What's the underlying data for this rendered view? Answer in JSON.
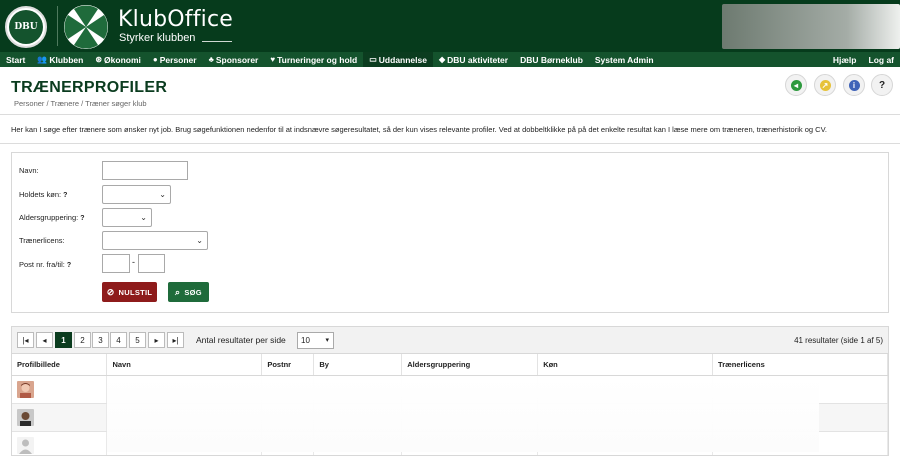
{
  "header": {
    "dbu_logo_text": "DBU",
    "brand_title": "KlubOffice",
    "brand_subtitle": "Styrker klubben"
  },
  "nav": {
    "items": [
      {
        "label": "Start",
        "icon": ""
      },
      {
        "label": "Klubben",
        "icon": "people-icon"
      },
      {
        "label": "Økonomi",
        "icon": "coin-icon"
      },
      {
        "label": "Personer",
        "icon": "person-icon"
      },
      {
        "label": "Sponsorer",
        "icon": "sponsor-icon"
      },
      {
        "label": "Turneringer og hold",
        "icon": "trophy-icon"
      },
      {
        "label": "Uddannelse",
        "icon": "monitor-icon",
        "active": true
      },
      {
        "label": "DBU aktiviteter",
        "icon": "graduation-icon"
      },
      {
        "label": "DBU Børneklub",
        "icon": ""
      },
      {
        "label": "System Admin",
        "icon": ""
      }
    ],
    "right": [
      "Hjælp",
      "Log af"
    ]
  },
  "page": {
    "title": "TRÆNERPROFILER",
    "breadcrumb": "Personer / Trænere / Træner søger klub",
    "intro": "Her kan I søge efter trænere som ønsker nyt job. Brug søgefunktionen nedenfor til at indsnævre søgeresultatet, så der kun vises relevante profiler. Ved at dobbeltklikke på på det enkelte resultat kan I læse mere om træneren, trænerhistorik og CV."
  },
  "toolbar_buttons": {
    "back_icon": "back-arrow-icon",
    "export_icon": "export-icon",
    "info_icon": "info-icon",
    "help_symbol": "?"
  },
  "search": {
    "name_label": "Navn:",
    "name_value": "",
    "team_gender_label": "Holdets køn:",
    "team_gender_value": "",
    "age_group_label": "Aldersgruppering:",
    "age_group_value": "",
    "license_label": "Trænerlicens:",
    "license_value": "",
    "postal_label": "Post nr. fra/til:",
    "postal_from": "",
    "postal_to": "",
    "postal_sep": "-",
    "help_symbol": "?",
    "reset_label": "NULSTIL",
    "search_label": "SØG"
  },
  "results": {
    "pages": [
      "1",
      "2",
      "3",
      "4",
      "5"
    ],
    "current_page": "1",
    "first_symbol": "|◂",
    "prev_symbol": "◂",
    "next_symbol": "▸",
    "last_symbol": "▸|",
    "per_page_label": "Antal resultater per side",
    "per_page_value": "10",
    "count_text": "41 resultater (side 1 af 5)",
    "columns": [
      "Profilbillede",
      "Navn",
      "Postnr",
      "By",
      "Aldersgruppering",
      "Køn",
      "Trænerlicens"
    ]
  },
  "colors": {
    "header_bg": "#063b1c",
    "nav_bg": "#14532d",
    "title": "#0b3c1f",
    "reset": "#8e1b1b",
    "search": "#1f6b3b"
  }
}
